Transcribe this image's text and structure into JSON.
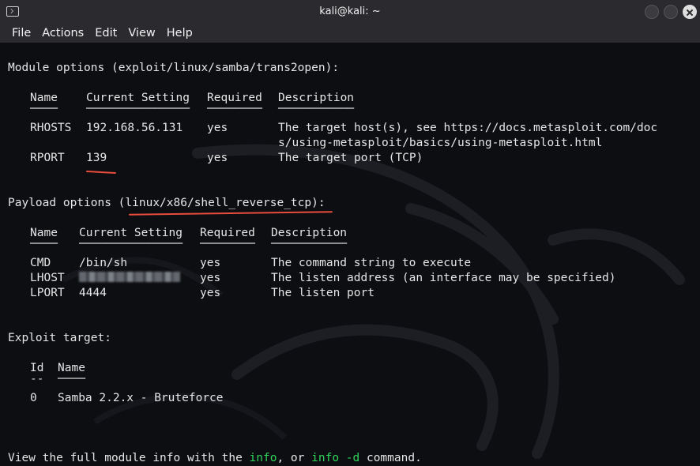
{
  "window": {
    "title": "kali@kali: ~"
  },
  "menu": [
    "File",
    "Actions",
    "Edit",
    "View",
    "Help"
  ],
  "module": {
    "header_prefix": "Module options (",
    "path": "exploit/linux/samba/trans2open",
    "header_suffix": "):",
    "columns": [
      "Name",
      "Current Setting",
      "Required",
      "Description"
    ],
    "underlines": [
      "────",
      "───────────────",
      "────────",
      "───────────"
    ],
    "rows": [
      {
        "name": "RHOSTS",
        "value": "192.168.56.131",
        "required": "yes",
        "desc": "The target host(s), see https://docs.metasploit.com/doc",
        "desc2": "s/using-metasploit/basics/using-metasploit.html"
      },
      {
        "name": "RPORT",
        "value": "139",
        "required": "yes",
        "desc": "The target port (TCP)"
      }
    ]
  },
  "payload": {
    "header_prefix": "Payload options (",
    "path": "linux/x86/shell_reverse_tcp",
    "header_suffix": "):",
    "columns": [
      "Name",
      "Current Setting",
      "Required",
      "Description"
    ],
    "underlines": [
      "────",
      "───────────────",
      "────────",
      "───────────"
    ],
    "rows": [
      {
        "name": "CMD",
        "value": "/bin/sh",
        "required": "yes",
        "desc": "The command string to execute"
      },
      {
        "name": "LHOST",
        "value": "",
        "required": "yes",
        "desc": "The listen address (an interface may be specified)"
      },
      {
        "name": "LPORT",
        "value": "4444",
        "required": "yes",
        "desc": "The listen port"
      }
    ]
  },
  "exploit_target": {
    "header": "Exploit target:",
    "columns": [
      "Id",
      "Name"
    ],
    "underlines": [
      "--",
      "────"
    ],
    "rows": [
      {
        "id": "0",
        "name": "Samba 2.2.x - Bruteforce"
      }
    ]
  },
  "footer": {
    "prefix": "View the full module info with the ",
    "cmd1": "info",
    "middle": ", or ",
    "cmd2": "info -d",
    "suffix": " command."
  },
  "colors": {
    "titlebar": "#2b2b2f",
    "terminal_bg": "#0d0e12",
    "text": "#e6e6e6",
    "command_green": "#2fd35a",
    "annotation_red": "#e74c3c"
  },
  "icons": [
    "terminal-app-icon",
    "minimize-icon",
    "maximize-icon",
    "close-icon"
  ]
}
